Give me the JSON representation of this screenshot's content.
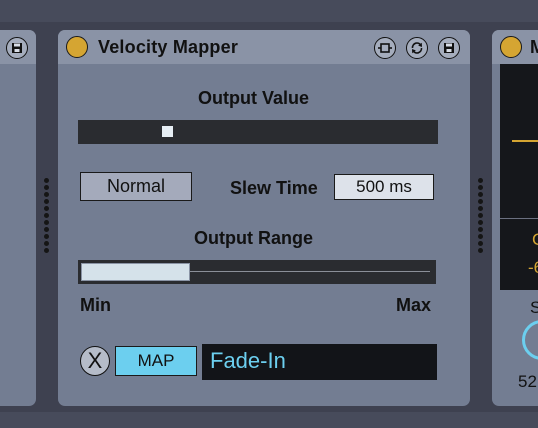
{
  "devices": {
    "main": {
      "title": "Velocity Mapper",
      "output_value": {
        "label": "Output Value",
        "level": 0.24
      },
      "mode_button": "Normal",
      "slew": {
        "label": "Slew Time",
        "value": "500 ms"
      },
      "output_range": {
        "label": "Output Range",
        "low_fraction": 0.0,
        "high_fraction": 0.31,
        "min_label": "Min",
        "max_label": "Max"
      },
      "mapping": {
        "remove_label": "X",
        "map_label": "MAP",
        "target": "Fade-In"
      }
    },
    "right": {
      "title_fragment": "M",
      "readout_1": "C",
      "readout_2": "-6",
      "label": "S",
      "value": "52"
    }
  },
  "colors": {
    "accent_yellow": "#d5a532",
    "accent_cyan": "#6ccfef",
    "device_bg": "#737d92",
    "titlebar_bg": "#8a93a6"
  },
  "icons": [
    "save-icon",
    "power-icon",
    "resize-icon",
    "refresh-icon"
  ]
}
